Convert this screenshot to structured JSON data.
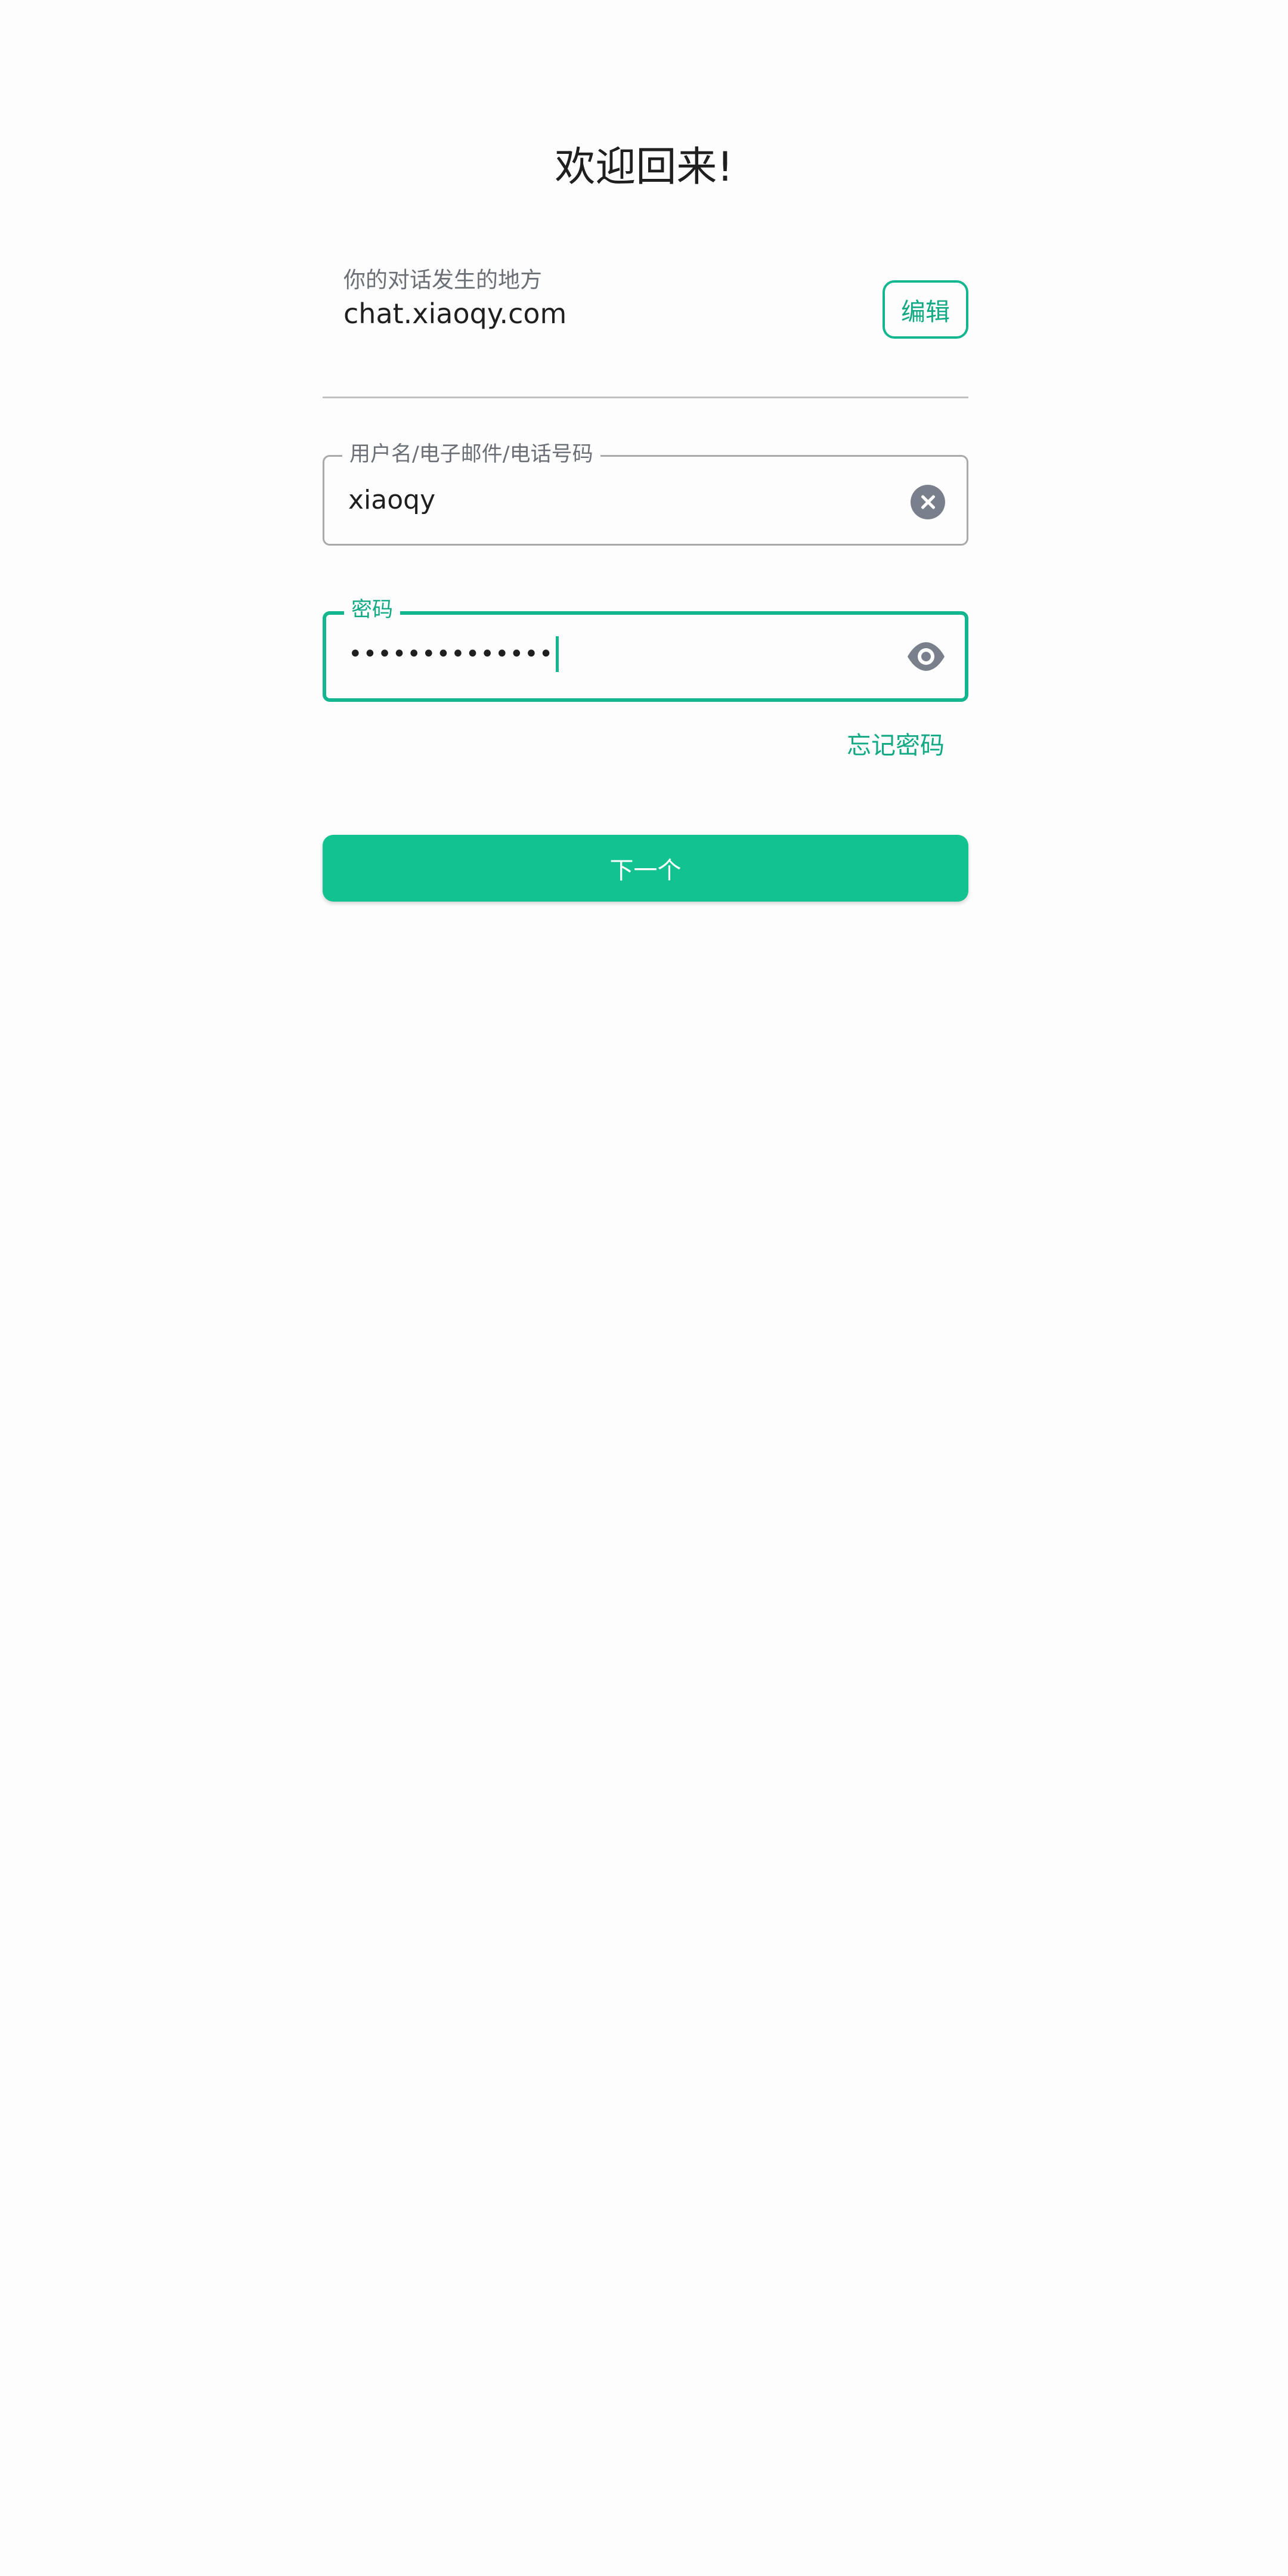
{
  "login": {
    "title": "欢迎回来!",
    "server": {
      "label": "你的对话发生的地方",
      "value": "chat.xiaoqy.com",
      "edit_label": "编辑"
    },
    "username_field": {
      "label": "用户名/电子邮件/电话号码",
      "value": "xiaoqy",
      "clear_icon": "clear-circle-icon"
    },
    "password_field": {
      "label": "密码",
      "masked_value": "••••••••••••••",
      "visibility_icon": "eye-icon"
    },
    "forgot_password_label": "忘记密码",
    "next_button_label": "下一个"
  },
  "colors": {
    "accent": "#13b68f",
    "button": "#13c291",
    "icon_gray": "#7a808b",
    "text": "#1f1f1f",
    "muted_text": "#6b6f76"
  }
}
